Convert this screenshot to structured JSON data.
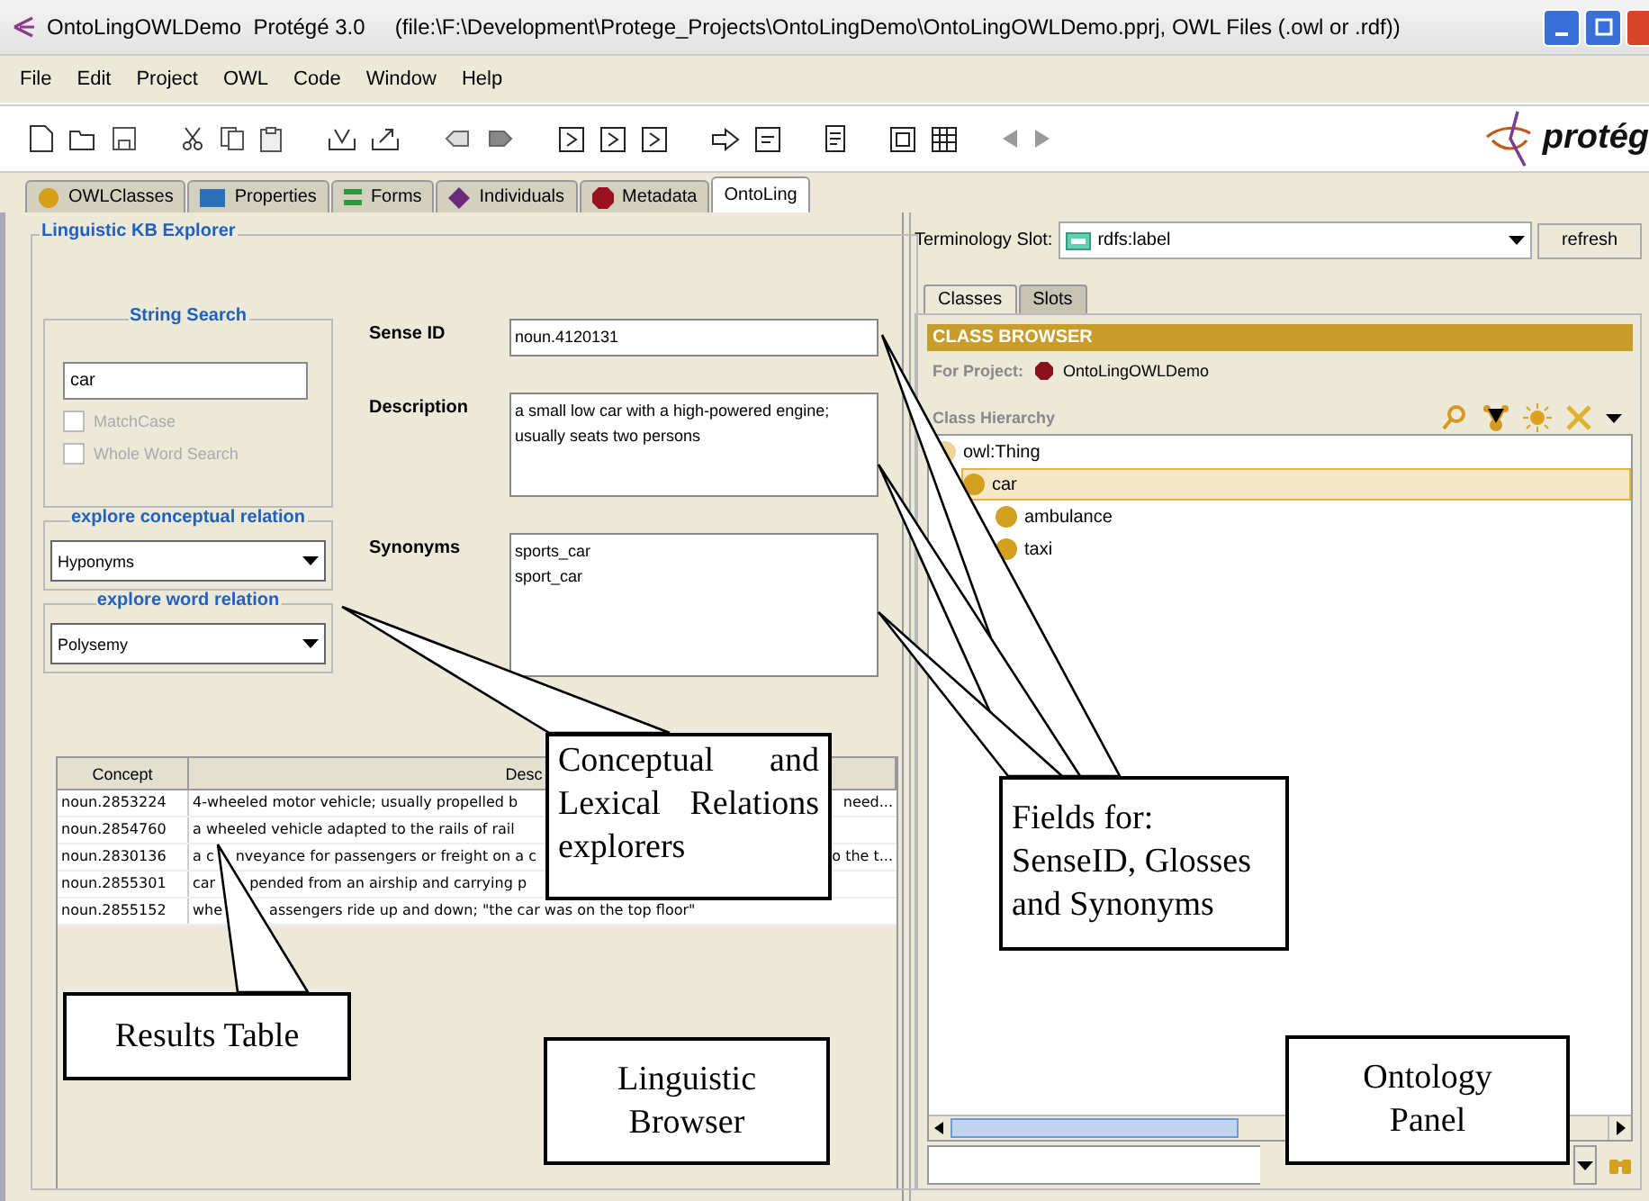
{
  "window": {
    "title": "OntoLingOWLDemo  Protégé 3.0     (file:\\F:\\Development\\Protege_Projects\\OntoLingDemo\\OntoLingOWLDemo.pprj, OWL Files (.owl or .rdf))"
  },
  "menu": [
    "File",
    "Edit",
    "Project",
    "OWL",
    "Code",
    "Window",
    "Help"
  ],
  "logo": "protég",
  "tabs": [
    {
      "label": "OWLClasses",
      "selected": false
    },
    {
      "label": "Properties",
      "selected": false
    },
    {
      "label": "Forms",
      "selected": false
    },
    {
      "label": "Individuals",
      "selected": false
    },
    {
      "label": "Metadata",
      "selected": false
    },
    {
      "label": "OntoLing",
      "selected": true
    }
  ],
  "left_panel": {
    "title": "Linguistic KB Explorer",
    "string_search": {
      "title": "String Search",
      "value": "car",
      "options": [
        {
          "label": "MatchCase",
          "checked": false,
          "disabled": true
        },
        {
          "label": "Whole Word Search",
          "checked": false,
          "disabled": true
        }
      ]
    },
    "relations": [
      {
        "title": "explore conceptual relation",
        "value": "Hyponyms"
      },
      {
        "title": "explore word relation",
        "value": "Polysemy"
      }
    ],
    "fields": [
      {
        "label": "Sense ID",
        "kind": "line",
        "lines": [
          "noun.4120131"
        ]
      },
      {
        "label": "Description",
        "kind": "area",
        "lines": [
          "a small low car with a high-powered engine;",
          "usually seats two persons"
        ]
      },
      {
        "label": "Synonyms",
        "kind": "list",
        "lines": [
          "sports_car",
          "sport_car"
        ]
      }
    ]
  },
  "results_table": {
    "columns": [
      "Concept",
      "Desc"
    ],
    "rows": [
      {
        "concept": "noun.2853224",
        "description": "4-wheeled motor vehicle; usually propelled b",
        "description_end": "need..."
      },
      {
        "concept": "noun.2854760",
        "description": "a wheeled vehicle adapted to the rails of rail"
      },
      {
        "concept": "noun.2830136",
        "description": "a c",
        "description_rest": "nveyance for passengers or freight on a c",
        "description_end": "o the t..."
      },
      {
        "concept": "noun.2855301",
        "description": "car",
        "description_rest": "pended from an airship and carrying p"
      },
      {
        "concept": "noun.2855152",
        "description": "whe",
        "description_rest": "assengers ride up and down; \"the car was on the top floor\""
      }
    ]
  },
  "right_panel": {
    "terminology_slot": {
      "label": "Terminology Slot:",
      "value": "rdfs:label"
    },
    "refresh": "refresh",
    "tabs": [
      {
        "label": "Classes",
        "selected": true
      },
      {
        "label": "Slots",
        "selected": false
      }
    ],
    "header": "CLASS BROWSER",
    "for_project": {
      "label": "For Project:",
      "value": "OntoLingOWLDemo"
    },
    "hierarchy_title": "Class Hierarchy",
    "tree": [
      {
        "label": "owl:Thing",
        "selected": false,
        "children": [
          {
            "label": "car",
            "selected": true,
            "children": [
              {
                "label": "ambulance",
                "selected": false
              },
              {
                "label": "taxi",
                "selected": false
              }
            ]
          }
        ]
      }
    ]
  },
  "callouts": [
    {
      "lines": [
        "Conceptual and",
        "Lexical Relations",
        "explorers"
      ]
    },
    {
      "lines": [
        "Fields for:",
        "SenseID, Glosses",
        "and Synonyms"
      ]
    },
    {
      "lines": [
        "Results Table"
      ]
    },
    {
      "lines": [
        "Linguistic",
        "Browser"
      ]
    },
    {
      "lines": [
        "Ontology",
        "Panel"
      ]
    }
  ]
}
